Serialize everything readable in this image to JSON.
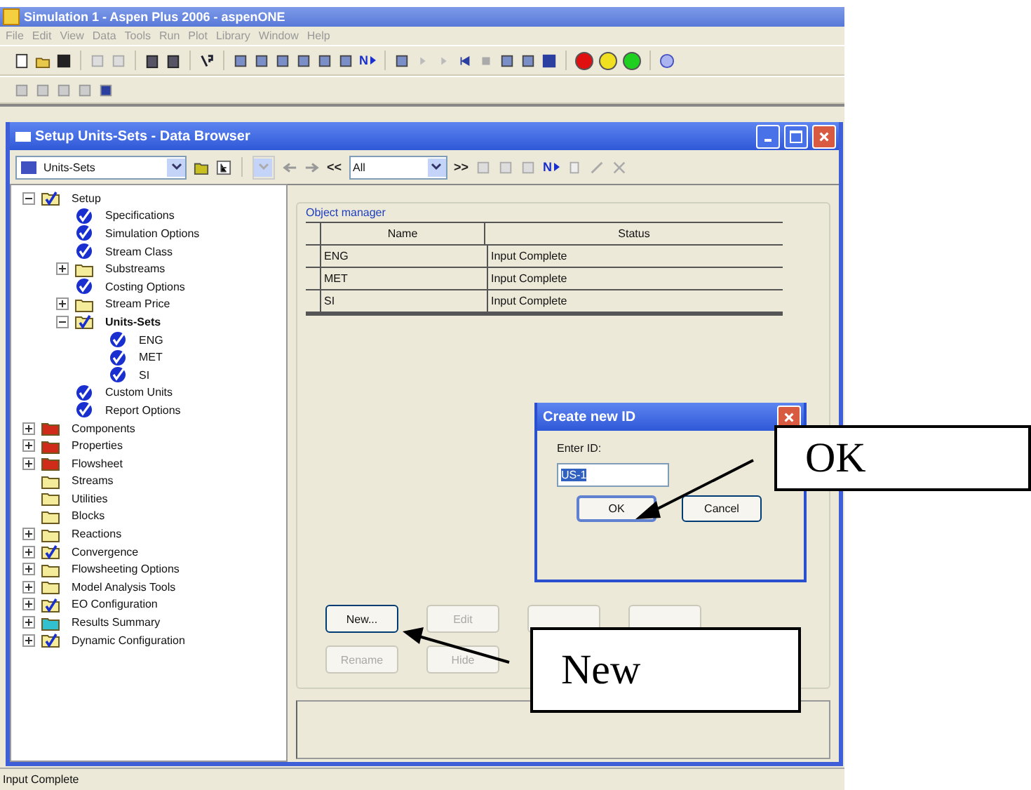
{
  "app_window": {
    "title": "Simulation 1 - Aspen Plus 2006 - aspenONE",
    "menu": [
      "File",
      "Edit",
      "View",
      "Data",
      "Tools",
      "Run",
      "Plot",
      "Library",
      "Window",
      "Help"
    ],
    "toolbar_next_label": "N"
  },
  "data_browser": {
    "title": "Setup Units-Sets - Data Browser",
    "toolbar": {
      "object_combo": "Units-Sets",
      "prev_label": "<<",
      "filter_combo": "All",
      "next_label": ">>",
      "next_button": "N"
    },
    "tree": [
      {
        "label": "Setup",
        "kind": "checked-folder",
        "expanded": true,
        "selected": false,
        "children": [
          {
            "label": "Specifications",
            "kind": "check",
            "selected": false
          },
          {
            "label": "Simulation Options",
            "kind": "check",
            "selected": false
          },
          {
            "label": "Stream Class",
            "kind": "check",
            "selected": false
          },
          {
            "label": "Substreams",
            "kind": "folder",
            "expanded": false,
            "selected": false
          },
          {
            "label": "Costing Options",
            "kind": "check",
            "selected": false
          },
          {
            "label": "Stream Price",
            "kind": "folder",
            "expanded": false,
            "selected": false
          },
          {
            "label": "Units-Sets",
            "kind": "checked-folder",
            "expanded": true,
            "selected": true,
            "children": [
              {
                "label": "ENG",
                "kind": "check",
                "selected": false
              },
              {
                "label": "MET",
                "kind": "check",
                "selected": false
              },
              {
                "label": "SI",
                "kind": "check",
                "selected": false
              }
            ]
          },
          {
            "label": "Custom Units",
            "kind": "check",
            "selected": false
          },
          {
            "label": "Report Options",
            "kind": "check",
            "selected": false
          }
        ]
      },
      {
        "label": "Components",
        "kind": "red-folder",
        "expanded": false,
        "selected": false
      },
      {
        "label": "Properties",
        "kind": "red-folder",
        "expanded": false,
        "selected": false
      },
      {
        "label": "Flowsheet",
        "kind": "red-folder",
        "expanded": false,
        "selected": false
      },
      {
        "label": "Streams",
        "kind": "folder",
        "selected": false
      },
      {
        "label": "Utilities",
        "kind": "folder",
        "selected": false
      },
      {
        "label": "Blocks",
        "kind": "folder",
        "selected": false
      },
      {
        "label": "Reactions",
        "kind": "folder",
        "expanded": false,
        "selected": false
      },
      {
        "label": "Convergence",
        "kind": "checked-folder",
        "expanded": false,
        "selected": false
      },
      {
        "label": "Flowsheeting Options",
        "kind": "folder",
        "expanded": false,
        "selected": false
      },
      {
        "label": "Model Analysis Tools",
        "kind": "folder",
        "expanded": false,
        "selected": false
      },
      {
        "label": "EO Configuration",
        "kind": "checked-folder",
        "expanded": false,
        "selected": false
      },
      {
        "label": "Results Summary",
        "kind": "cyan-folder",
        "expanded": false,
        "selected": false
      },
      {
        "label": "Dynamic Configuration",
        "kind": "checked-folder",
        "expanded": false,
        "selected": false
      }
    ],
    "object_manager": {
      "title": "Object manager",
      "columns": [
        "Name",
        "Status"
      ],
      "rows": [
        {
          "name": "ENG",
          "status": "Input Complete"
        },
        {
          "name": "MET",
          "status": "Input Complete"
        },
        {
          "name": "SI",
          "status": "Input Complete"
        }
      ],
      "buttons": [
        {
          "label": "New...",
          "disabled": false
        },
        {
          "label": "Edit",
          "disabled": true
        },
        {
          "disabled": true
        },
        {
          "disabled": true
        },
        {
          "label": "Rename",
          "disabled": true
        },
        {
          "label": "Hide",
          "disabled": true
        }
      ]
    }
  },
  "dialog": {
    "title": "Create new ID",
    "field_label": "Enter ID:",
    "value": "US-1",
    "buttons": [
      "OK",
      "Cancel"
    ]
  },
  "status_bar": "Input Complete",
  "callouts": [
    {
      "text": "OK"
    },
    {
      "text": "New"
    }
  ]
}
